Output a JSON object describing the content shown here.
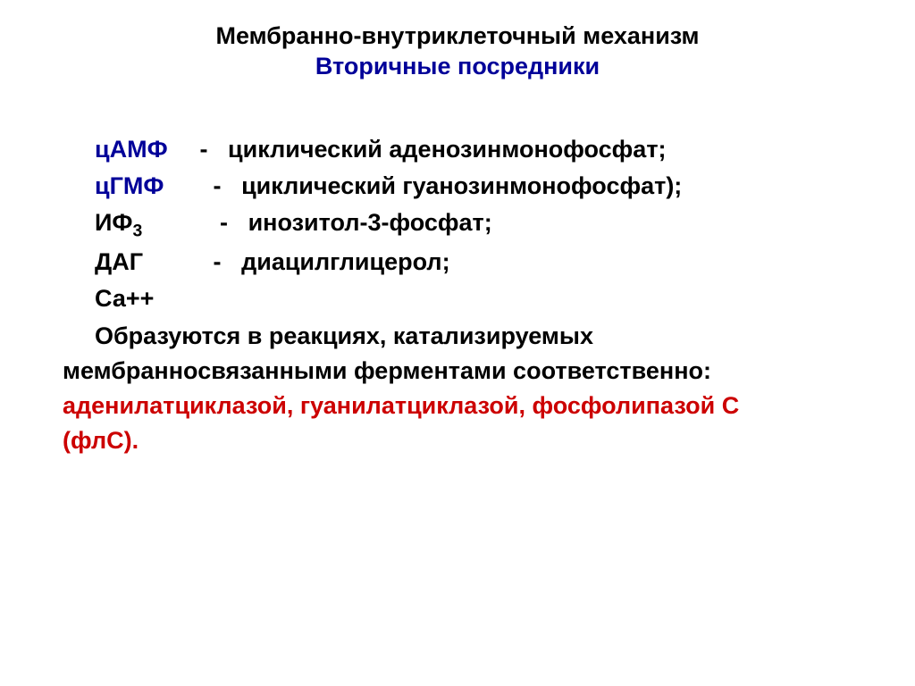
{
  "title": {
    "line1": "Мембранно-внутриклеточный механизм",
    "line2": "Вторичные посредники"
  },
  "defs": {
    "camp": {
      "abbr": "цАМФ",
      "dash": "-",
      "expansion": "циклический аденозинмонофосфат;"
    },
    "cgmp": {
      "abbr": "цГМФ",
      "dash": "-",
      "expansion": "циклический гуанозинмонофосфат);"
    },
    "ip3": {
      "abbr_pre": "ИФ",
      "abbr_sub": "3",
      "dash": "-",
      "expansion": "инозитол-3-фосфат;"
    },
    "dag": {
      "abbr": "ДАГ",
      "dash": "-",
      "expansion": "диацилглицерол;"
    },
    "ca": {
      "abbr": "Са++"
    }
  },
  "paragraph": {
    "black1": "Образуются в реакциях, катализируемых",
    "black2": "мембранносвязанными ферментами соответственно:",
    "red1": "аденилатциклазой, гуанилатциклазой, фосфолипазой С",
    "red2": "(флС)."
  }
}
